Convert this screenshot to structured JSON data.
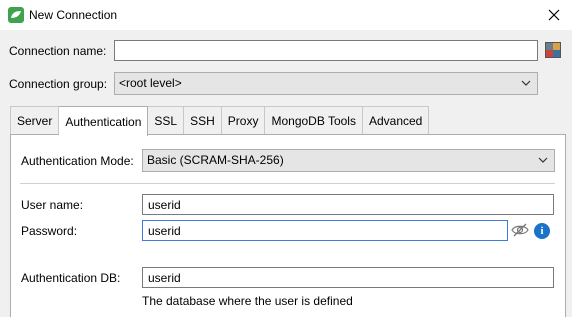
{
  "window": {
    "title": "New Connection"
  },
  "connection_name": {
    "label": "Connection name:",
    "value": ""
  },
  "connection_group": {
    "label": "Connection group:",
    "value": "<root level>"
  },
  "tabs": [
    {
      "label": "Server",
      "active": false
    },
    {
      "label": "Authentication",
      "active": true
    },
    {
      "label": "SSL",
      "active": false
    },
    {
      "label": "SSH",
      "active": false
    },
    {
      "label": "Proxy",
      "active": false
    },
    {
      "label": "MongoDB Tools",
      "active": false
    },
    {
      "label": "Advanced",
      "active": false
    }
  ],
  "auth": {
    "mode_label": "Authentication Mode:",
    "mode_value": "Basic (SCRAM-SHA-256)",
    "username_label": "User name:",
    "username_value": "userid",
    "password_label": "Password:",
    "password_value": "userid",
    "authdb_label": "Authentication DB:",
    "authdb_value": "userid",
    "authdb_hint": "The database where the user is defined"
  },
  "colors": {
    "accent": "#3b7dd8",
    "app_icon": "#3fa34d",
    "info": "#1a73c9"
  },
  "icons": {
    "app": "mongo-leaf-icon",
    "close": "close-icon",
    "color": "color-picker-icon",
    "eye": "eye-off-icon",
    "info": "info-icon",
    "chevron": "chevron-down-icon"
  }
}
